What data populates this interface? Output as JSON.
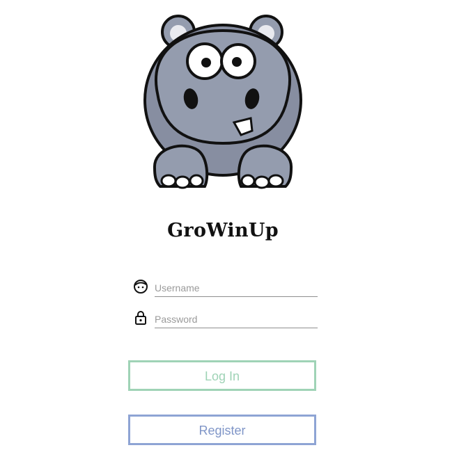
{
  "app": {
    "title": "GroWinUp"
  },
  "mascot": {
    "icon": "hippo-logo-icon"
  },
  "form": {
    "username": {
      "placeholder": "Username",
      "value": "",
      "icon": "user-face-icon"
    },
    "password": {
      "placeholder": "Password",
      "value": "",
      "icon": "lock-icon"
    }
  },
  "buttons": {
    "login_label": "Log In",
    "register_label": "Register"
  },
  "colors": {
    "login": "#9fd3b6",
    "register": "#8ea4d4",
    "hippo_body": "#949cae"
  }
}
